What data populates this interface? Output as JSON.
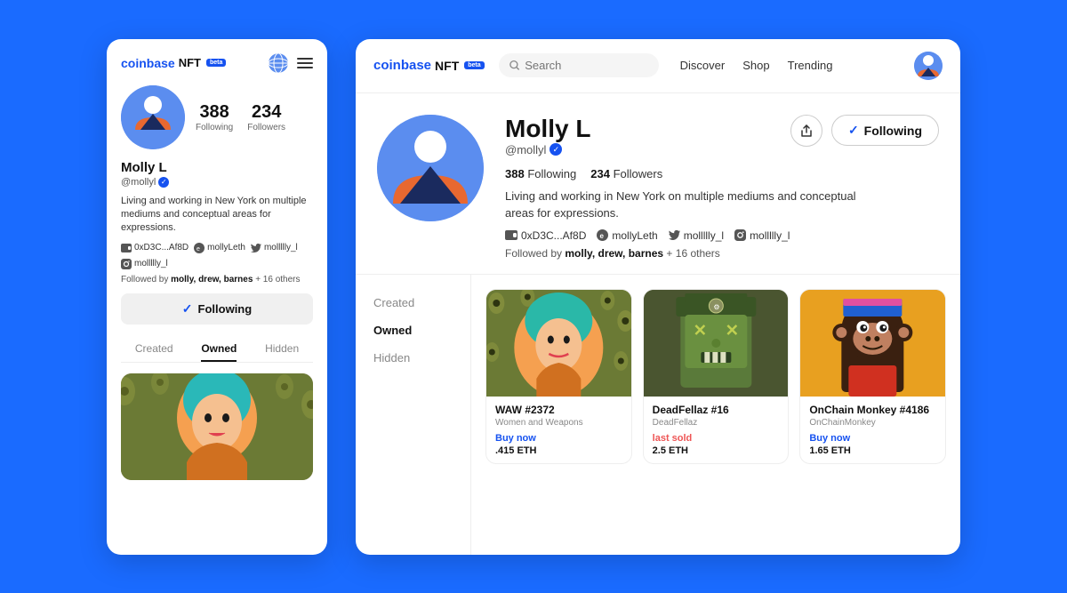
{
  "background_color": "#1a6bff",
  "mobile": {
    "logo": "coinbase",
    "logo_nft": "NFT",
    "beta": "beta",
    "stats": {
      "following": "388",
      "following_label": "Following",
      "followers": "234",
      "followers_label": "Followers"
    },
    "name": "Molly L",
    "handle": "@mollyl",
    "bio": "Living and working in New York on multiple mediums and conceptual areas for expressions.",
    "wallet": "0xD3C...Af8D",
    "ens": "mollyLeth",
    "twitter": "mollllly_l",
    "instagram": "mollllly_l",
    "followed_by_text": "Followed by ",
    "followed_by_users": "molly, drew, barnes",
    "followed_by_extra": "+ 16 others",
    "follow_button": "Following",
    "tabs": [
      "Created",
      "Owned",
      "Hidden"
    ],
    "active_tab": "Owned"
  },
  "desktop": {
    "logo": "coinbase",
    "logo_nft": "NFT",
    "beta": "beta",
    "nav": {
      "search_placeholder": "Search",
      "links": [
        "Discover",
        "Shop",
        "Trending"
      ]
    },
    "profile": {
      "name": "Molly L",
      "handle": "@mollyl",
      "stats": {
        "following": "388",
        "following_label": "Following",
        "followers": "234",
        "followers_label": "Followers"
      },
      "bio": "Living and working in New York on multiple mediums and conceptual areas for expressions.",
      "wallet": "0xD3C...Af8D",
      "ens": "mollyLeth",
      "twitter": "mollllly_l",
      "instagram": "mollllly_l",
      "followed_by_text": "Followed by ",
      "followed_by_users": "molly, drew, barnes",
      "followed_by_extra": "+ 16 others"
    },
    "buttons": {
      "share": "↑",
      "following": "Following"
    },
    "sidebar": [
      "Created",
      "Owned",
      "Hidden"
    ],
    "active_sidebar": "Owned",
    "nfts": [
      {
        "title": "WAW #2372",
        "collection": "Women and Weapons",
        "action": "Buy now",
        "action_type": "buy",
        "price": ".415 ETH",
        "bg": "#7A8C3E"
      },
      {
        "title": "DeadFellaz #16",
        "collection": "DeadFellaz",
        "action": "last sold",
        "action_type": "sold",
        "price": "2.5 ETH",
        "bg": "#5a6b3a"
      },
      {
        "title": "OnChain Monkey #4186",
        "collection": "OnChainMonkey",
        "action": "Buy now",
        "action_type": "buy",
        "price": "1.65 ETH",
        "bg": "#E8A020"
      }
    ]
  }
}
